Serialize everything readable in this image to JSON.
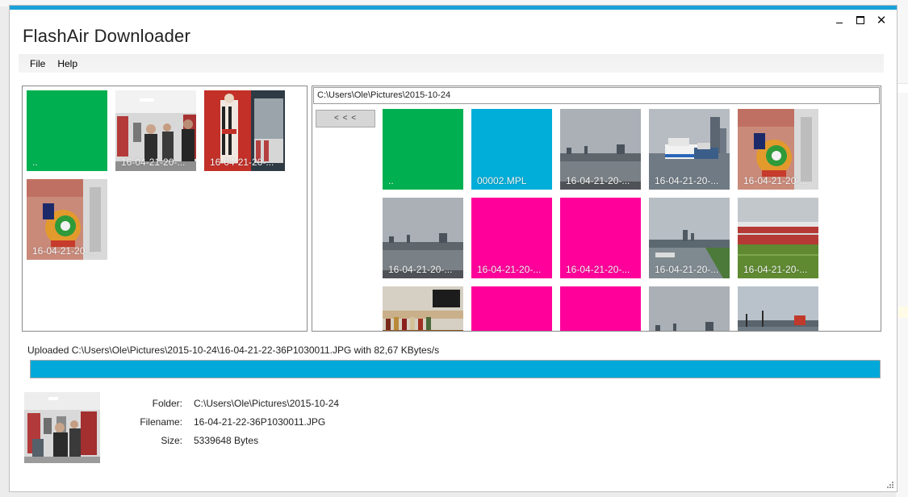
{
  "window": {
    "title": "FlashAir Downloader",
    "accent_color": "#1ba1d9",
    "controls": [
      "minimize-icon",
      "maximize-icon",
      "close-icon"
    ],
    "close_glyph": "✕"
  },
  "menu": {
    "items": [
      "File",
      "Help"
    ]
  },
  "left_panel": {
    "tiles": [
      {
        "label": "..",
        "kind": "color",
        "color": "#00b050"
      },
      {
        "label": "16-04-21-20-...",
        "kind": "photo-locker"
      },
      {
        "label": "16-04-21-20-...",
        "kind": "photo-mural-red"
      },
      {
        "label": "16-04-21-20-...",
        "kind": "photo-graffiti"
      }
    ]
  },
  "right_panel": {
    "path": "C:\\Users\\Ole\\Pictures\\2015-10-24",
    "back_button": "< < <",
    "tiles": [
      {
        "label": "..",
        "kind": "color",
        "color": "#00b050"
      },
      {
        "label": "00002.MPL",
        "kind": "color",
        "color": "#00aed9"
      },
      {
        "label": "16-04-21-20-...",
        "kind": "photo-harbor"
      },
      {
        "label": "16-04-21-20-...",
        "kind": "photo-ship"
      },
      {
        "label": "16-04-21-20-...",
        "kind": "photo-graffiti"
      },
      {
        "label": "16-04-21-20-...",
        "kind": "photo-harbor"
      },
      {
        "label": "16-04-21-20-...",
        "kind": "color",
        "color": "#ff009a"
      },
      {
        "label": "16-04-21-20-...",
        "kind": "color",
        "color": "#ff009a"
      },
      {
        "label": "16-04-21-20-...",
        "kind": "photo-river"
      },
      {
        "label": "16-04-21-20-...",
        "kind": "photo-stadium"
      },
      {
        "label": "",
        "kind": "photo-bar"
      },
      {
        "label": "",
        "kind": "color",
        "color": "#ff009a"
      },
      {
        "label": "",
        "kind": "color",
        "color": "#ff009a"
      },
      {
        "label": "",
        "kind": "photo-harbor"
      },
      {
        "label": "",
        "kind": "photo-port"
      }
    ]
  },
  "status": {
    "message": "Uploaded C:\\Users\\Ole\\Pictures\\2015-10-24\\16-04-21-22-36P1030011.JPG with 82,67 KBytes/s",
    "progress_percent": 100,
    "progress_color": "#00a9d9"
  },
  "details": {
    "folder_label": "Folder:",
    "folder_value": "C:\\Users\\Ole\\Pictures\\2015-10-24",
    "filename_label": "Filename:",
    "filename_value": "16-04-21-22-36P1030011.JPG",
    "size_label": "Size:",
    "size_value": "5339648 Bytes"
  }
}
